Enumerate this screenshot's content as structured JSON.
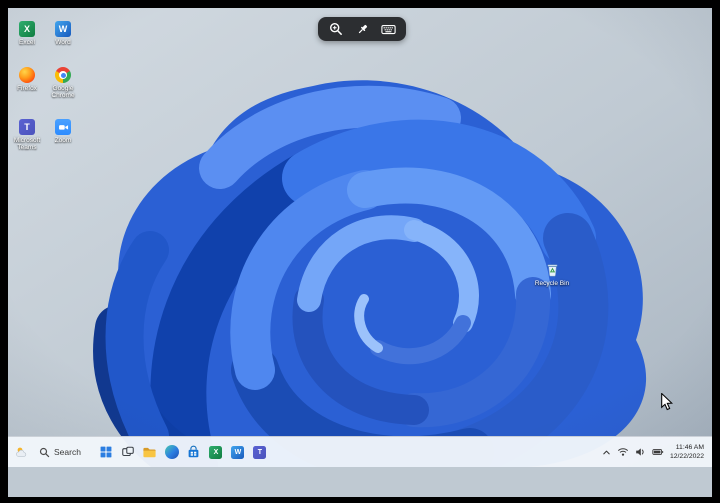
{
  "overlay_toolbar": {
    "buttons": [
      {
        "name": "Zoom in"
      },
      {
        "name": "Pin"
      },
      {
        "name": "Keyboard"
      }
    ]
  },
  "desktop": {
    "wallpaper": "windows-11-bloom-blue",
    "icons": [
      {
        "label": "Excel",
        "glyph": "X"
      },
      {
        "label": "Word",
        "glyph": "W"
      },
      {
        "label": "Firefox"
      },
      {
        "label": "Google Chrome"
      },
      {
        "label": "Microsoft Teams",
        "glyph": "T"
      },
      {
        "label": "Zoom"
      },
      {
        "label": "Recycle Bin"
      }
    ]
  },
  "taskbar": {
    "widgets": {
      "name": "Widgets"
    },
    "search": {
      "label": "Search"
    },
    "pinned_apps": [
      {
        "name": "Start"
      },
      {
        "name": "Task View"
      },
      {
        "name": "File Explorer"
      },
      {
        "name": "Microsoft Edge"
      },
      {
        "name": "Microsoft Store"
      },
      {
        "name": "Excel",
        "glyph": "X"
      },
      {
        "name": "Word",
        "glyph": "W"
      },
      {
        "name": "Microsoft Teams",
        "glyph": "T"
      }
    ],
    "tray": {
      "hidden_icons": "Show hidden icons",
      "icons": [
        "network",
        "volume",
        "battery"
      ],
      "time": "11:46 AM",
      "date": "12/22/2022"
    }
  },
  "colors": {
    "bloom_primary": "#2b60d4",
    "bloom_dark": "#0e3fa8",
    "bloom_light": "#74a6f8",
    "taskbar_bg": "#f1f6fb",
    "desktop_bg_top": "#d0d8df",
    "desktop_bg_bottom": "#a9b5c1"
  }
}
